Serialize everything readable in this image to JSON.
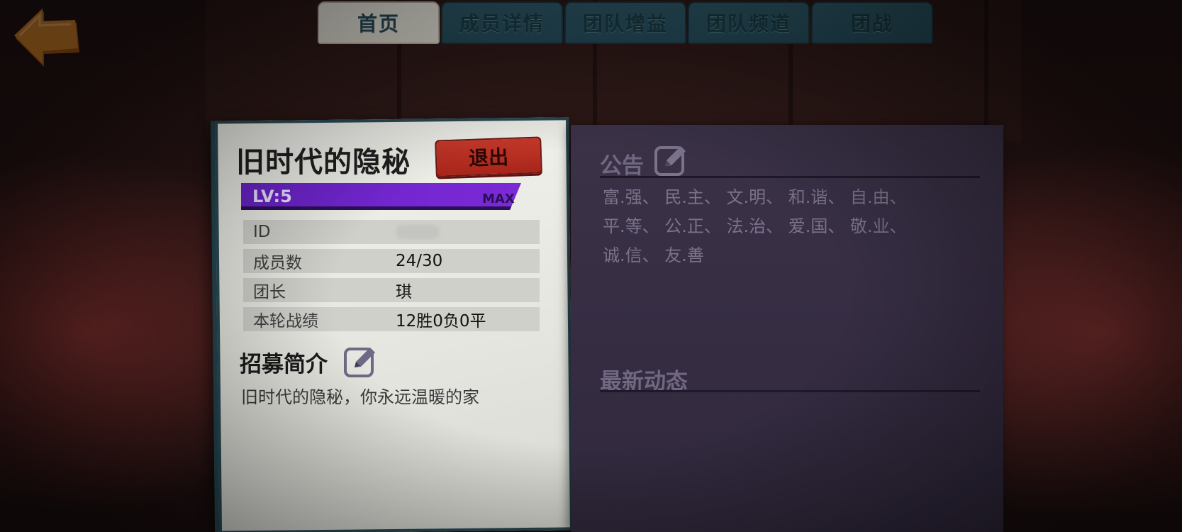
{
  "tabs": [
    {
      "label": "首页",
      "active": true
    },
    {
      "label": "成员详情",
      "active": false
    },
    {
      "label": "团队增益",
      "active": false
    },
    {
      "label": "团队频道",
      "active": false
    },
    {
      "label": "团战",
      "active": false
    }
  ],
  "guild": {
    "name": "旧时代的隐秘",
    "quit_label": "退出",
    "level_label": "LV:5",
    "max_label": "MAX"
  },
  "info": {
    "id_label": "ID",
    "members_label": "成员数",
    "members_value": "24/30",
    "leader_label": "团长",
    "leader_value": "琪",
    "record_label": "本轮战绩",
    "record_value": "12胜0负0平"
  },
  "recruit": {
    "title": "招募简介",
    "text": "旧时代的隐秘，你永远温暖的家"
  },
  "notice": {
    "title": "公告",
    "line1": "富.强、 民.主、 文.明、 和.谐、 自.由、",
    "line2": "平.等、 公.正、 法.治、 爱.国、 敬.业、",
    "line3": "诚.信、 友.善"
  },
  "news": {
    "title": "最新动态"
  },
  "colors": {
    "tab_inactive": "#2f5b6b",
    "tab_active": "#f2f0e8",
    "quit_red": "#c8392b",
    "level_purple": "#7b2ad6",
    "board_purple": "#3b3248",
    "back_arrow_orange": "#e08a2c"
  },
  "icons": {
    "back": "back-arrow-icon",
    "edit": "edit-pencil-icon"
  }
}
